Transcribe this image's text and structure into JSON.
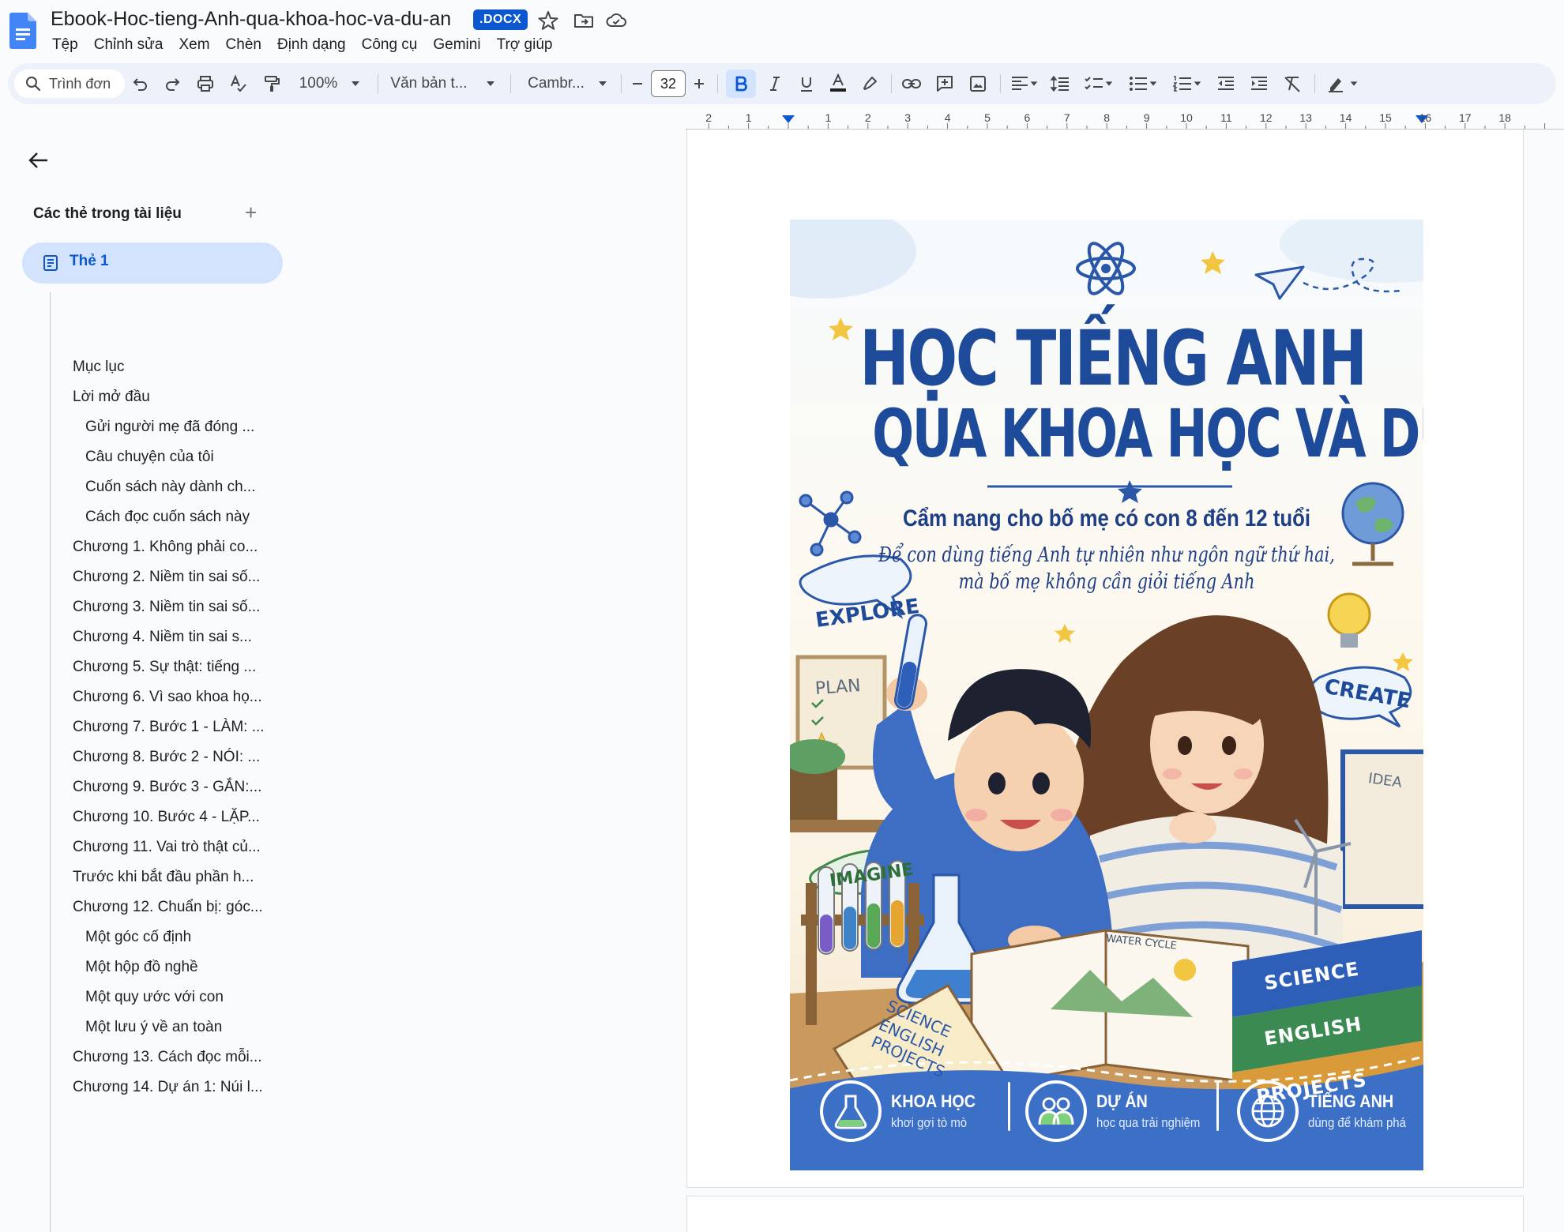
{
  "document": {
    "title": "Ebook-Hoc-tieng-Anh-qua-khoa-hoc-va-du-an",
    "file_badge": ".DOCX"
  },
  "menu": [
    "Tệp",
    "Chỉnh sửa",
    "Xem",
    "Chèn",
    "Định dạng",
    "Công cụ",
    "Gemini",
    "Trợ giúp"
  ],
  "toolbar": {
    "search_menus": "Trình đơn",
    "zoom": "100%",
    "style": "Văn bản t...",
    "font": "Cambr...",
    "font_size": "32"
  },
  "ruler": {
    "numbers": [
      "2",
      "1",
      "1",
      "2",
      "3",
      "4",
      "5",
      "6",
      "7",
      "8",
      "9",
      "10",
      "11",
      "12",
      "13",
      "14",
      "15",
      "16",
      "17",
      "18"
    ]
  },
  "sidebar": {
    "heading": "Các thẻ trong tài liệu",
    "add_symbol": "+",
    "active_tab": "Thẻ 1",
    "outline": [
      {
        "label": "Mục lục",
        "level": 1
      },
      {
        "label": "Lời mở đầu",
        "level": 1
      },
      {
        "label": "Gửi người mẹ đã đóng ...",
        "level": 2
      },
      {
        "label": "Câu chuyện của tôi",
        "level": 2
      },
      {
        "label": "Cuốn sách này dành ch...",
        "level": 2
      },
      {
        "label": "Cách đọc cuốn sách này",
        "level": 2
      },
      {
        "label": "Chương 1. Không phải co...",
        "level": 1
      },
      {
        "label": "Chương 2. Niềm tin sai số...",
        "level": 1
      },
      {
        "label": "Chương 3. Niềm tin sai số...",
        "level": 1
      },
      {
        "label": "Chương 4. Niềm tin sai s...",
        "level": 1
      },
      {
        "label": "Chương 5. Sự thật: tiếng ...",
        "level": 1
      },
      {
        "label": "Chương 6. Vì sao khoa họ...",
        "level": 1
      },
      {
        "label": "Chương 7. Bước 1 - LÀM: ...",
        "level": 1
      },
      {
        "label": "Chương 8. Bước 2 - NÓI: ...",
        "level": 1
      },
      {
        "label": "Chương 9. Bước 3 - GẮN:...",
        "level": 1
      },
      {
        "label": "Chương 10. Bước 4 - LẶP...",
        "level": 1
      },
      {
        "label": "Chương 11. Vai trò thật củ...",
        "level": 1
      },
      {
        "label": "Trước khi bắt đầu phần h...",
        "level": 1
      },
      {
        "label": "Chương 12. Chuẩn bị: góc...",
        "level": 1
      },
      {
        "label": "Một góc cố định",
        "level": 2
      },
      {
        "label": "Một hộp đồ nghề",
        "level": 2
      },
      {
        "label": "Một quy ước với con",
        "level": 2
      },
      {
        "label": "Một lưu ý về an toàn",
        "level": 2
      },
      {
        "label": "Chương 13. Cách đọc mỗi...",
        "level": 1
      },
      {
        "label": "Chương 14. Dự án 1: Núi l...",
        "level": 1
      }
    ]
  },
  "cover": {
    "title_line1": "HỌC TIẾNG ANH",
    "title_line2": "QUA KHOA HỌC VÀ DỰ ÁN",
    "subtitle": "Cẩm nang cho bố mẹ có con 8 đến 12 tuổi",
    "tagline_line1": "Để con dùng tiếng Anh tự nhiên như ngôn ngữ thứ hai,",
    "tagline_line2": "mà bố mẹ không cần giỏi tiếng Anh",
    "bubbles": [
      "EXPLORE",
      "CREATE",
      "IMAGINE"
    ],
    "signs": [
      "PLAN",
      "IDEA"
    ],
    "book_spines": [
      "SCIENCE",
      "ENGLISH",
      "PROJECTS"
    ],
    "notebook_lines": [
      "SCIENCE",
      "ENGLISH",
      "PROJECTS"
    ],
    "open_book_label": "WATER CYCLE",
    "features": [
      {
        "title": "KHOA HỌC",
        "subtitle": "khơi gợi tò mò",
        "icon": "flask-icon"
      },
      {
        "title": "DỰ ÁN",
        "subtitle": "học qua trải nghiệm",
        "icon": "people-icon"
      },
      {
        "title": "TIẾNG ANH",
        "subtitle": "dùng để khám phá",
        "icon": "globe-icon"
      }
    ],
    "colors": {
      "title": "#1e4a9a",
      "band": "#3c6fc6"
    }
  }
}
